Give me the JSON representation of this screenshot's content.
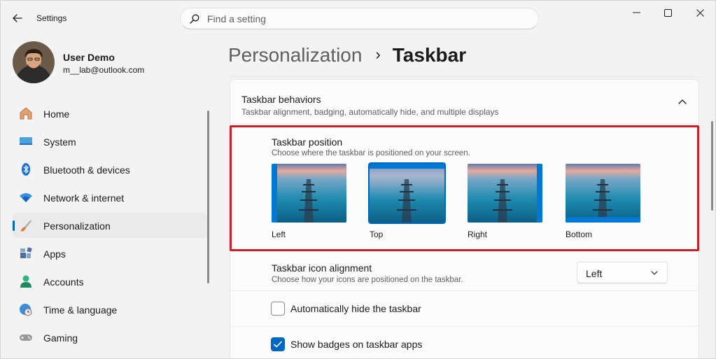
{
  "window": {
    "app_title": "Settings",
    "minimize_icon": "minimize-icon",
    "maximize_icon": "maximize-icon",
    "close_icon": "close-icon"
  },
  "search": {
    "placeholder": "Find a setting",
    "value": ""
  },
  "profile": {
    "name": "User Demo",
    "email": "m__lab@outlook.com"
  },
  "sidebar": {
    "items": [
      {
        "label": "Home",
        "icon": "home-icon",
        "active": false
      },
      {
        "label": "System",
        "icon": "monitor-icon",
        "active": false
      },
      {
        "label": "Bluetooth & devices",
        "icon": "bluetooth-icon",
        "active": false
      },
      {
        "label": "Network & internet",
        "icon": "wifi-icon",
        "active": false
      },
      {
        "label": "Personalization",
        "icon": "paint-brush-icon",
        "active": true
      },
      {
        "label": "Apps",
        "icon": "apps-icon",
        "active": false
      },
      {
        "label": "Accounts",
        "icon": "person-icon",
        "active": false
      },
      {
        "label": "Time & language",
        "icon": "globe-clock-icon",
        "active": false
      },
      {
        "label": "Gaming",
        "icon": "gamepad-icon",
        "active": false
      }
    ]
  },
  "breadcrumb": {
    "parent": "Personalization",
    "separator": "›",
    "current": "Taskbar"
  },
  "taskbar_behaviors": {
    "title": "Taskbar behaviors",
    "subtitle": "Taskbar alignment, badging, automatically hide, and multiple displays",
    "expanded": true
  },
  "taskbar_position": {
    "title": "Taskbar position",
    "subtitle": "Choose where the taskbar is positioned on your screen.",
    "options": [
      {
        "label": "Left",
        "selected": false
      },
      {
        "label": "Top",
        "selected": true
      },
      {
        "label": "Right",
        "selected": false
      },
      {
        "label": "Bottom",
        "selected": false
      }
    ]
  },
  "icon_alignment": {
    "title": "Taskbar icon alignment",
    "subtitle": "Choose how your icons are positioned on the taskbar.",
    "value": "Left"
  },
  "auto_hide": {
    "label": "Automatically hide the taskbar",
    "checked": false
  },
  "badges": {
    "label": "Show badges on taskbar apps",
    "checked": true
  },
  "colors": {
    "accent": "#0067c0",
    "highlight_border": "#cd1f2a",
    "taskbar_blue": "#0078d4"
  }
}
